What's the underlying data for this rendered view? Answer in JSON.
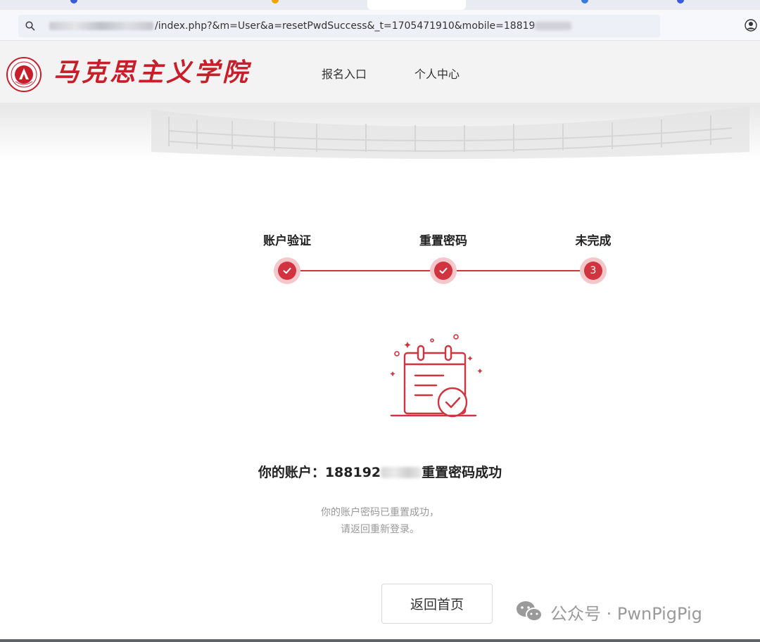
{
  "browser": {
    "address_url": "/index.php?&m=User&a=resetPwdSuccess&_t=1705471910&mobile=18819"
  },
  "header": {
    "logo_text": "马克思主义学院",
    "nav": [
      "报名入口",
      "个人中心"
    ]
  },
  "steps": [
    {
      "label": "账户验证",
      "state": "done"
    },
    {
      "label": "重置密码",
      "state": "done"
    },
    {
      "label": "未完成",
      "state": "current",
      "number": "3"
    }
  ],
  "result": {
    "title_prefix": "你的账户：",
    "account_visible": "188192",
    "title_suffix": "重置密码成功",
    "desc_line1": "你的账户密码已重置成功，",
    "desc_line2": "请返回重新登录。"
  },
  "back_button_label": "返回首页",
  "watermark": "公众号 · PwnPigPig",
  "colors": {
    "accent": "#d1343f",
    "accent_light": "#f4c8cb",
    "logo_red": "#c81e2a"
  }
}
